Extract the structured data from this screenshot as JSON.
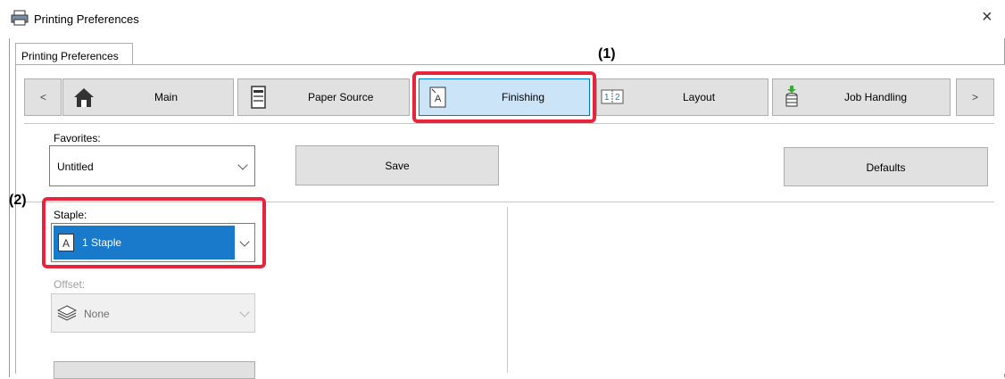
{
  "window": {
    "title": "Printing Preferences",
    "close_glyph": "×"
  },
  "tabs": [
    {
      "label": "Printing Preferences"
    }
  ],
  "nav": {
    "prev": "<",
    "next": ">",
    "items": [
      {
        "label": "Main",
        "icon": "home-icon"
      },
      {
        "label": "Paper Source",
        "icon": "paper-tray-icon"
      },
      {
        "label": "Finishing",
        "icon": "staple-page-icon",
        "selected": true
      },
      {
        "label": "Layout",
        "icon": "layout-pages-icon"
      },
      {
        "label": "Job Handling",
        "icon": "job-storage-icon"
      }
    ]
  },
  "favorites": {
    "label": "Favorites:",
    "value": "Untitled",
    "save": "Save",
    "defaults": "Defaults"
  },
  "staple": {
    "label": "Staple:",
    "value": "1 Staple",
    "icon_letter": "A"
  },
  "offset": {
    "label": "Offset:",
    "value": "None",
    "disabled": true
  },
  "callouts": {
    "one": "(1)",
    "two": "(2)"
  },
  "colors": {
    "accent": "#1979ca",
    "highlight": "#e8233c",
    "selected_bg": "#cce4f7"
  }
}
